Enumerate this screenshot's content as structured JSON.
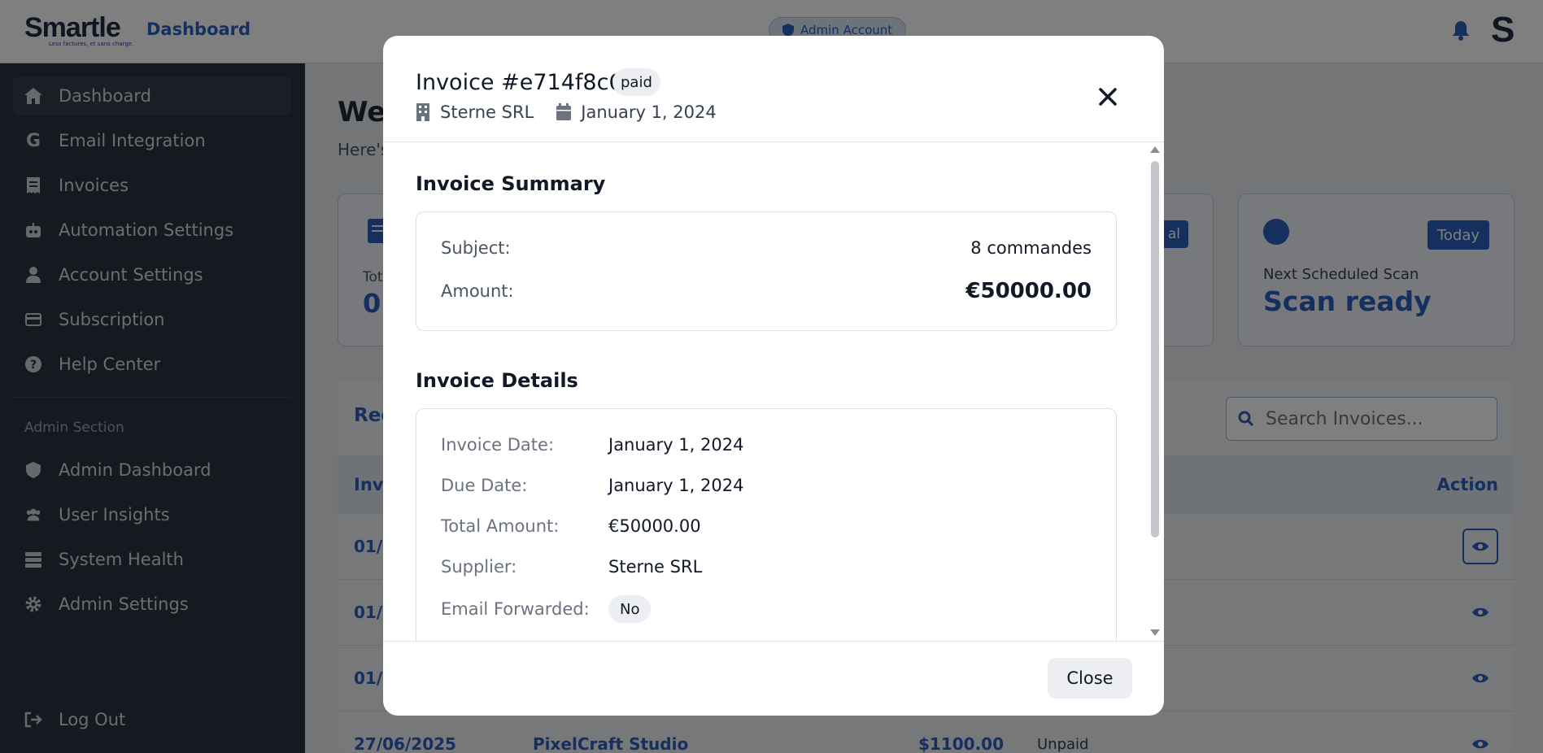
{
  "topbar": {
    "logo_text": "Smartle",
    "logo_tagline": "Less factures, et sans charge.",
    "nav_label": "Dashboard",
    "admin_badge": "Admin Account",
    "avatar_glyph": "S"
  },
  "sidebar": {
    "items": [
      {
        "label": "Dashboard",
        "icon": "home-icon"
      },
      {
        "label": "Email Integration",
        "icon": "google-icon"
      },
      {
        "label": "Invoices",
        "icon": "receipt-icon"
      },
      {
        "label": "Automation Settings",
        "icon": "robot-icon"
      },
      {
        "label": "Account Settings",
        "icon": "user-icon"
      },
      {
        "label": "Subscription",
        "icon": "card-icon"
      },
      {
        "label": "Help Center",
        "icon": "help-icon"
      }
    ],
    "admin_section_label": "Admin Section",
    "admin_items": [
      {
        "label": "Admin Dashboard",
        "icon": "shield-icon"
      },
      {
        "label": "User Insights",
        "icon": "users-icon"
      },
      {
        "label": "System Health",
        "icon": "server-icon"
      },
      {
        "label": "Admin Settings",
        "icon": "gear-icon"
      }
    ],
    "logout_label": "Log Out"
  },
  "background": {
    "welcome": "Wel",
    "subtitle": "Here's",
    "card1_label": "Tot",
    "card1_value": "0",
    "mid_badge": "al",
    "today_badge": "Today",
    "next_scan_label": "Next Scheduled Scan",
    "next_scan_value": "Scan ready",
    "recent_title": "Rec",
    "search_placeholder": "Search Invoices...",
    "col_invoice": "Inv",
    "col_action": "Action",
    "rows": [
      {
        "date": "01/0",
        "supplier": "",
        "amount": "",
        "status": ""
      },
      {
        "date": "01/0",
        "supplier": "",
        "amount": "",
        "status": ""
      },
      {
        "date": "01/0",
        "supplier": "",
        "amount": "",
        "status": ""
      },
      {
        "date": "27/06/2025",
        "supplier": "PixelCraft Studio",
        "amount": "$1100.00",
        "status": "Unpaid"
      }
    ]
  },
  "modal": {
    "title": "Invoice #e714f8c6",
    "status_pill": "paid",
    "supplier": "Sterne SRL",
    "date": "January 1, 2024",
    "summary_title": "Invoice Summary",
    "summary": {
      "subject_label": "Subject:",
      "subject_value": "8 commandes",
      "amount_label": "Amount:",
      "amount_value": "€50000.00"
    },
    "details_title": "Invoice Details",
    "details": [
      {
        "label": "Invoice Date:",
        "value": "January 1, 2024"
      },
      {
        "label": "Due Date:",
        "value": "January 1, 2024"
      },
      {
        "label": "Total Amount:",
        "value": "€50000.00"
      },
      {
        "label": "Supplier:",
        "value": "Sterne SRL"
      }
    ],
    "email_forwarded_label": "Email Forwarded:",
    "email_forwarded_value": "No",
    "close_label": "Close"
  },
  "colors": {
    "accent": "#2b5fbd",
    "sidebar_bg": "#2a3441",
    "overlay": "rgba(0,0,0,0.5)"
  }
}
